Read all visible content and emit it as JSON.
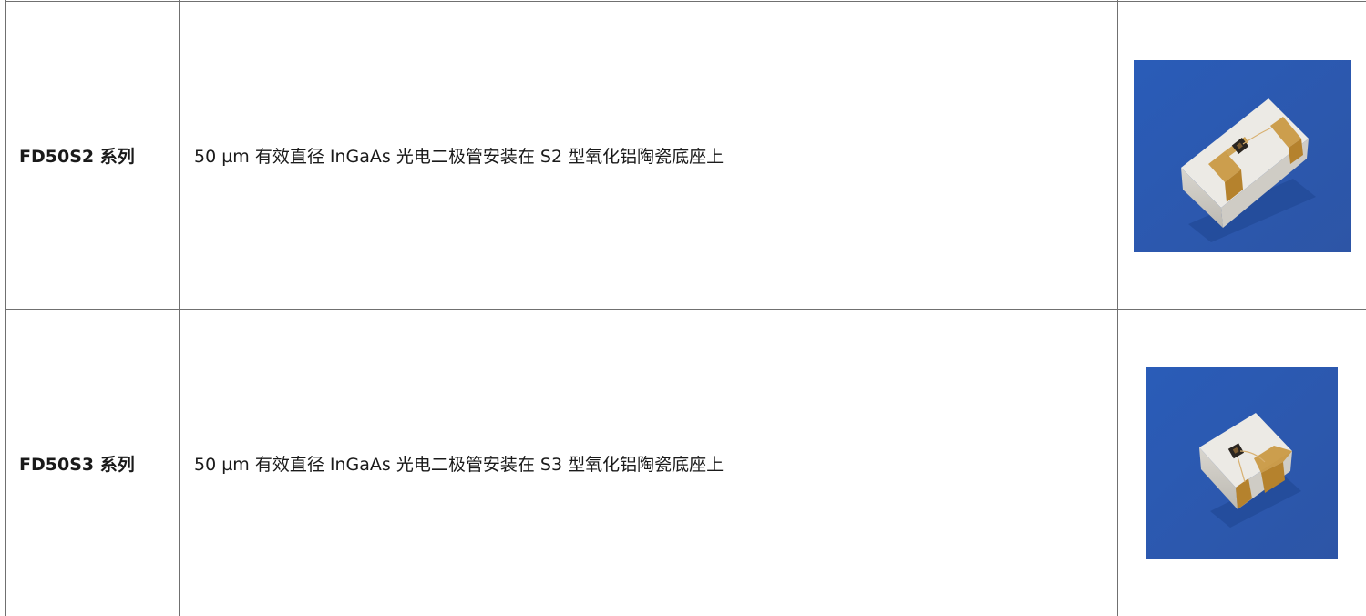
{
  "rows": [
    {
      "name": "FD50S2 系列",
      "description": "50 µm 有效直径 InGaAs 光电二极管安装在 S2 型氧化铝陶瓷底座上",
      "image": "photo of white ceramic submount on blue background"
    },
    {
      "name": "FD50S3 系列",
      "description": "50 µm 有效直径 InGaAs 光电二极管安装在 S3 型氧化铝陶瓷底座上",
      "image": "photo of white ceramic submount on blue background"
    }
  ],
  "colors": {
    "border": "#707070",
    "photo_background": "#2c5ab0",
    "ceramic": "#e6e4df",
    "gold_pad": "#c9963c"
  }
}
